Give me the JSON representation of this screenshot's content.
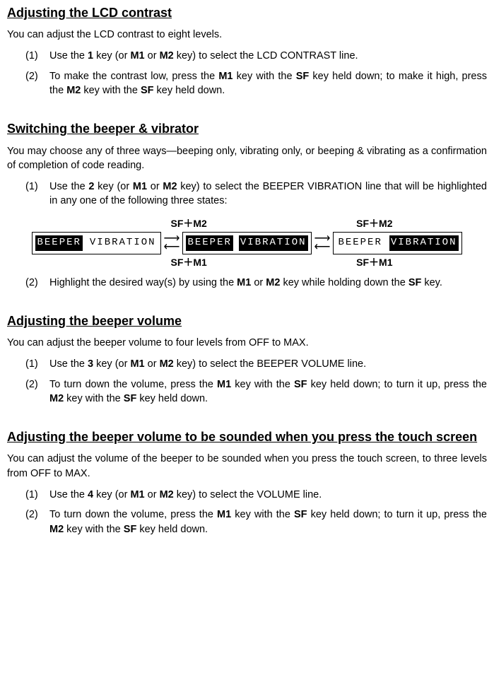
{
  "s1": {
    "title": "Adjusting the LCD contrast",
    "intro": "You can adjust the LCD contrast to eight levels.",
    "li1_num": "(1)",
    "li1_a": "Use the ",
    "li1_key1": "1",
    "li1_b": " key (or ",
    "li1_key2": "M1",
    "li1_c": " or ",
    "li1_key3": "M2",
    "li1_d": " key) to select the LCD CONTRAST line.",
    "li2_num": "(2)",
    "li2_a": "To make the contrast low, press the ",
    "li2_key1": "M1",
    "li2_b": " key with the ",
    "li2_key2": "SF",
    "li2_c": " key held down; to make it high, press the ",
    "li2_key3": "M2",
    "li2_d": " key with the ",
    "li2_key4": "SF",
    "li2_e": " key held down."
  },
  "s2": {
    "title": "Switching the beeper & vibrator",
    "intro": "You may choose any of three ways—beeping only, vibrating only, or beeping & vibrating as a confirmation of completion of code reading.",
    "li1_num": "(1)",
    "li1_a": "Use the ",
    "li1_key1": "2",
    "li1_b": " key (or ",
    "li1_key2": "M1",
    "li1_c": " or ",
    "li1_key3": "M2",
    "li1_d": " key) to select the BEEPER VIBRATION line that will be highlighted in any one of the following three states:",
    "top_label": "SF＋M2",
    "bot_label": "SF＋M1",
    "beeper": "BEEPER",
    "vibration": "VIBRATION",
    "li2_num": "(2)",
    "li2_a": "Highlight the desired way(s) by using the ",
    "li2_key1": "M1",
    "li2_b": " or ",
    "li2_key2": "M2",
    "li2_c": " key while holding down the ",
    "li2_key3": "SF",
    "li2_d": " key."
  },
  "s3": {
    "title": "Adjusting the beeper volume",
    "intro": "You can adjust the beeper volume to four levels from OFF to MAX.",
    "li1_num": "(1)",
    "li1_a": "Use the ",
    "li1_key1": "3",
    "li1_b": " key (or ",
    "li1_key2": "M1",
    "li1_c": " or ",
    "li1_key3": "M2",
    "li1_d": " key) to select the BEEPER VOLUME line.",
    "li2_num": "(2)",
    "li2_a": "To turn down the volume, press the ",
    "li2_key1": "M1",
    "li2_b": " key with the ",
    "li2_key2": "SF",
    "li2_c": " key held down; to turn it up, press the ",
    "li2_key3": "M2",
    "li2_d": " key with the ",
    "li2_key4": "SF",
    "li2_e": " key held down."
  },
  "s4": {
    "title": "Adjusting the beeper volume to be sounded when you press the touch screen",
    "intro": "You can adjust the volume of the beeper to be sounded when you press the touch screen, to three levels from OFF to MAX.",
    "li1_num": "(1)",
    "li1_a": "Use the ",
    "li1_key1": "4",
    "li1_b": " key (or ",
    "li1_key2": "M1",
    "li1_c": " or ",
    "li1_key3": "M2",
    "li1_d": " key) to select the VOLUME line.",
    "li2_num": "(2)",
    "li2_a": "To turn down the volume, press the ",
    "li2_key1": "M1",
    "li2_b": " key with the ",
    "li2_key2": "SF",
    "li2_c": " key held down; to turn it up, press the ",
    "li2_key3": "M2",
    "li2_d": " key with the ",
    "li2_key4": "SF",
    "li2_e": " key held down."
  }
}
